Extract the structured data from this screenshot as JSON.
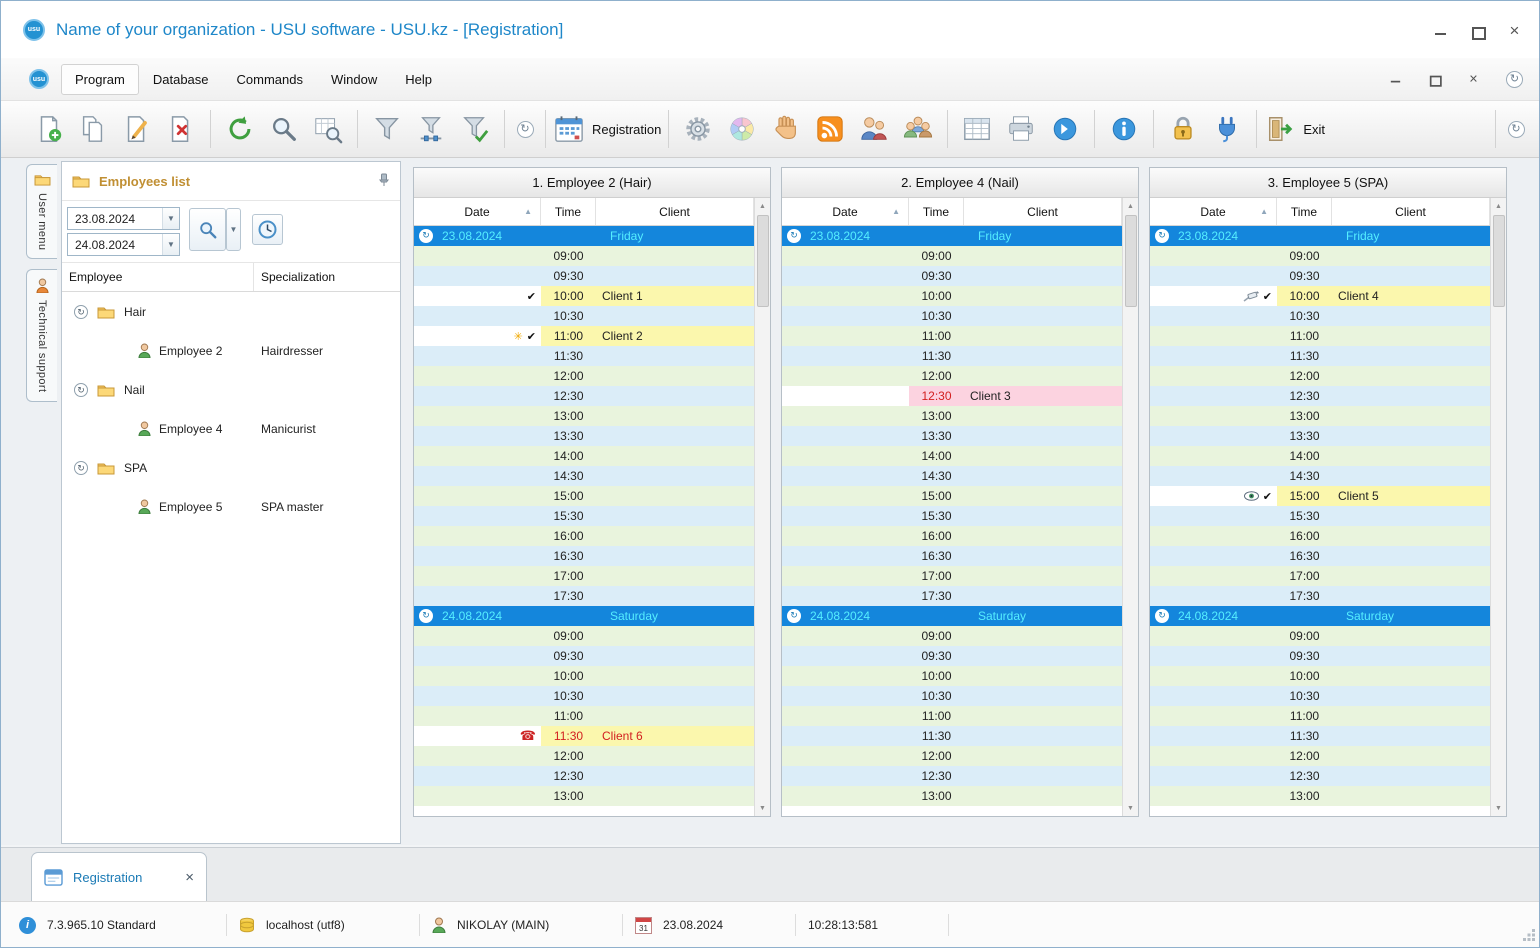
{
  "window": {
    "title": "Name of your organization - USU software - USU.kz - [Registration]",
    "logo_text": "usu"
  },
  "menu": {
    "items": [
      "Program",
      "Database",
      "Commands",
      "Window",
      "Help"
    ]
  },
  "toolbar": {
    "registration_label": "Registration",
    "exit_label": "Exit",
    "buttons": [
      "add-record",
      "copy-record",
      "edit-record",
      "delete-record",
      "refresh",
      "search",
      "search-in-table",
      "filter",
      "filter-settings",
      "filter-apply",
      "quick-access",
      "registration",
      "settings",
      "appearance",
      "pan-mode",
      "news-feed",
      "user-management",
      "group-management",
      "table-view",
      "print",
      "navigate-next",
      "about",
      "lock",
      "connection",
      "exit",
      "more-commands"
    ]
  },
  "side_tabs": [
    {
      "label": "User menu",
      "icon": "folder-icon"
    },
    {
      "label": "Technical support",
      "icon": "person-icon"
    }
  ],
  "employees_panel": {
    "title": "Employees list",
    "date_from": "23.08.2024",
    "date_to": "24.08.2024",
    "columns": [
      "Employee",
      "Specialization"
    ],
    "groups": [
      {
        "name": "Hair",
        "employees": [
          {
            "name": "Employee 2",
            "specialization": "Hairdresser"
          }
        ]
      },
      {
        "name": "Nail",
        "employees": [
          {
            "name": "Employee 4",
            "specialization": "Manicurist"
          }
        ]
      },
      {
        "name": "SPA",
        "employees": [
          {
            "name": "Employee 5",
            "specialization": "SPA master"
          }
        ]
      }
    ]
  },
  "schedule": {
    "columns": [
      "Date",
      "Time",
      "Client"
    ],
    "sort_column": "Date",
    "sort_order": "ascending",
    "days": [
      {
        "date": "23.08.2024",
        "day": "Friday",
        "times": [
          "09:00",
          "09:30",
          "10:00",
          "10:30",
          "11:00",
          "11:30",
          "12:00",
          "12:30",
          "13:00",
          "13:30",
          "14:00",
          "14:30",
          "15:00",
          "15:30",
          "16:00",
          "16:30",
          "17:00",
          "17:30"
        ]
      },
      {
        "date": "24.08.2024",
        "day": "Saturday",
        "times": [
          "09:00",
          "09:30",
          "10:00",
          "10:30",
          "11:00",
          "11:30",
          "12:00",
          "12:30",
          "13:00"
        ]
      }
    ],
    "panels": [
      {
        "title": "1. Employee 2 (Hair)",
        "bookings": [
          {
            "day": 0,
            "time": "10:00",
            "client": "Client 1",
            "icons": [
              "check"
            ],
            "highlight": "yellow"
          },
          {
            "day": 0,
            "time": "11:00",
            "client": "Client 2",
            "icons": [
              "star",
              "check"
            ],
            "highlight": "yellow"
          },
          {
            "day": 1,
            "time": "11:30",
            "client": "Client 6",
            "icons": [
              "phone"
            ],
            "highlight": "yellow",
            "red_time": true,
            "red_client": true
          }
        ]
      },
      {
        "title": "2. Employee 4 (Nail)",
        "bookings": [
          {
            "day": 0,
            "time": "12:30",
            "client": "Client 3",
            "icons": [],
            "highlight": "pink",
            "red_time": true
          }
        ]
      },
      {
        "title": "3. Employee 5 (SPA)",
        "bookings": [
          {
            "day": 0,
            "time": "10:00",
            "client": "Client 4",
            "icons": [
              "syringe",
              "check"
            ],
            "highlight": "yellow"
          },
          {
            "day": 0,
            "time": "15:00",
            "client": "Client 5",
            "icons": [
              "eye",
              "check"
            ],
            "highlight": "yellow"
          }
        ]
      }
    ]
  },
  "bottom_tabs": [
    {
      "label": "Registration"
    }
  ],
  "status_bar": {
    "version": "7.3.965.10 Standard",
    "database": "localhost (utf8)",
    "user": "NIKOLAY (MAIN)",
    "calendar_day": "31",
    "date": "23.08.2024",
    "time": "10:28:13:581"
  },
  "colors": {
    "accent_blue": "#1e87c9",
    "date_row_blue": "#1486dc",
    "date_row_text": "#55eeff",
    "row_green": "#e9f4dd",
    "row_blue": "#dbedf8",
    "booking_yellow": "#fbf7ad",
    "booking_pink": "#fcd3e0",
    "alert_red": "#d21f1f",
    "employees_title": "#c08f33"
  }
}
